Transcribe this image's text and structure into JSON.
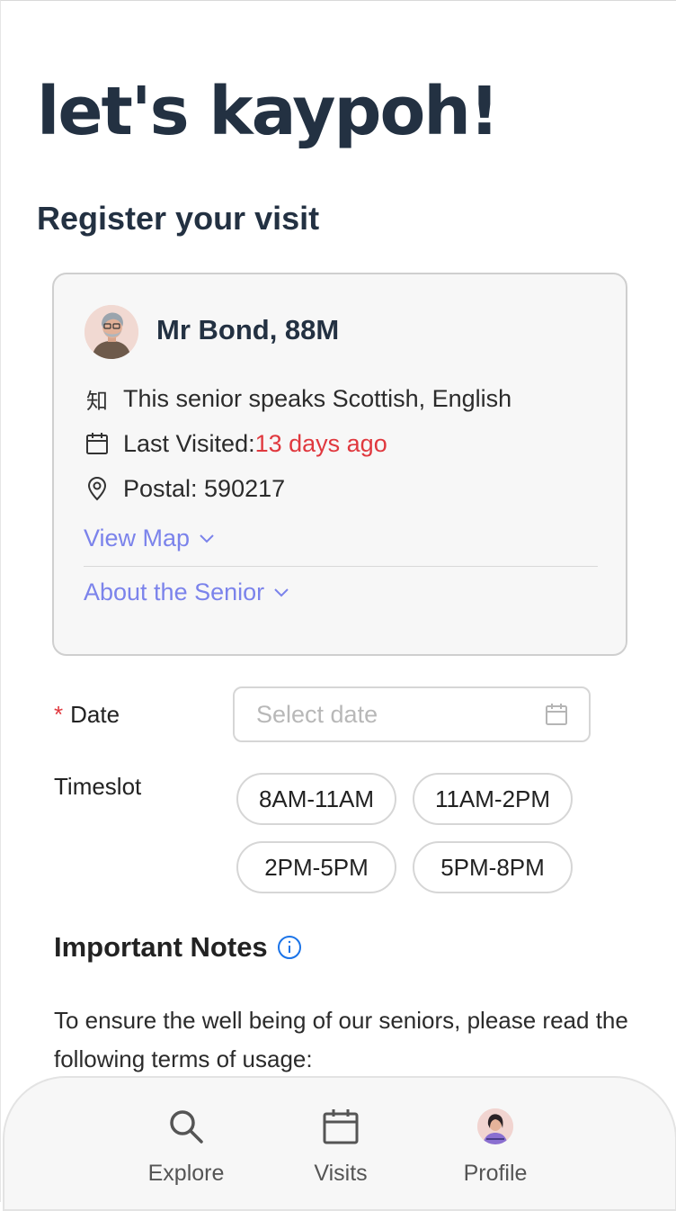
{
  "header": {
    "app_title": "let's kaypoh!",
    "section_title": "Register your visit"
  },
  "senior": {
    "name": "Mr Bond, 88M",
    "language_icon": "知",
    "languages": "This senior speaks Scottish, English",
    "last_visited_label": "Last Visited: ",
    "last_visited_value": "13 days ago",
    "postal": "Postal: 590217",
    "view_map": "View Map",
    "about": "About the Senior"
  },
  "form": {
    "date_required_mark": "*",
    "date_label": "Date",
    "date_placeholder": "Select date",
    "timeslot_label": "Timeslot",
    "timeslots": [
      "8AM-11AM",
      "11AM-2PM",
      "2PM-5PM",
      "5PM-8PM"
    ]
  },
  "notes": {
    "title": "Important Notes",
    "body": "To ensure the well being of our seniors, please read the following terms of usage:"
  },
  "nav": {
    "explore": "Explore",
    "visits": "Visits",
    "profile": "Profile"
  },
  "colors": {
    "primary_text": "#233142",
    "link": "#7b83eb",
    "alert": "#e0383e",
    "info": "#1a73e8"
  },
  "icons": [
    "language-icon",
    "calendar-icon",
    "location-pin-icon",
    "chevron-down-icon",
    "info-icon",
    "search-icon"
  ]
}
